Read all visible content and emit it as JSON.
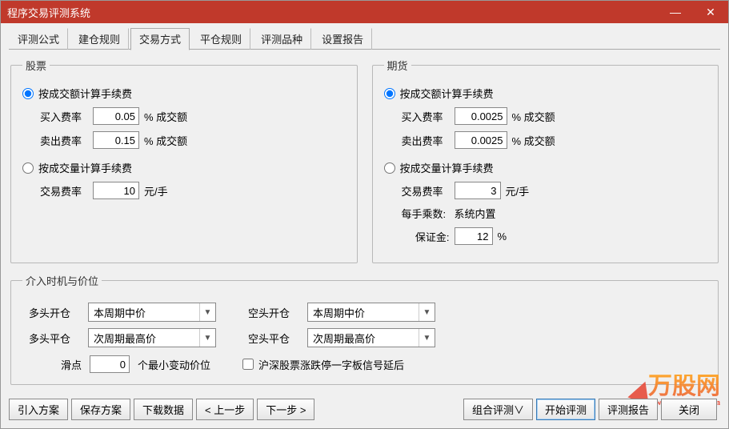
{
  "window": {
    "title": "程序交易评测系统"
  },
  "tabs": [
    "评测公式",
    "建仓规则",
    "交易方式",
    "平仓规则",
    "评测品种",
    "设置报告"
  ],
  "active_tab_index": 2,
  "stocks": {
    "legend": "股票",
    "by_amount_label": "按成交额计算手续费",
    "by_volume_label": "按成交量计算手续费",
    "buy_rate_label": "买入费率",
    "buy_rate_value": "0.05",
    "sell_rate_label": "卖出费率",
    "sell_rate_value": "0.15",
    "pct_of_amount": "% 成交额",
    "trade_rate_label": "交易费率",
    "trade_rate_value": "10",
    "per_hand": "元/手"
  },
  "futures": {
    "legend": "期货",
    "by_amount_label": "按成交额计算手续费",
    "by_volume_label": "按成交量计算手续费",
    "buy_rate_label": "买入费率",
    "buy_rate_value": "0.0025",
    "sell_rate_label": "卖出费率",
    "sell_rate_value": "0.0025",
    "pct_of_amount": "% 成交额",
    "trade_rate_label": "交易费率",
    "trade_rate_value": "3",
    "per_hand": "元/手",
    "multiplier_label": "每手乘数:",
    "multiplier_value": "系统内置",
    "margin_label": "保证金:",
    "margin_value": "12",
    "pct": "%"
  },
  "timing": {
    "legend": "介入时机与价位",
    "long_open_label": "多头开仓",
    "long_open_value": "本周期中价",
    "short_open_label": "空头开仓",
    "short_open_value": "本周期中价",
    "long_close_label": "多头平仓",
    "long_close_value": "次周期最高价",
    "short_close_label": "空头平仓",
    "short_close_value": "次周期最高价",
    "slippage_label": "滑点",
    "slippage_value": "0",
    "slippage_unit": "个最小变动价位",
    "delay_checkbox": "沪深股票涨跌停一字板信号延后"
  },
  "buttons": {
    "import": "引入方案",
    "save": "保存方案",
    "download": "下载数据",
    "prev": "< 上一步",
    "next": "下一步 >",
    "combo": "组合评测∨",
    "start": "开始评测",
    "report": "评测报告",
    "close": "关闭"
  },
  "watermark": {
    "brand": "万股网",
    "url": "www.201082.com"
  }
}
